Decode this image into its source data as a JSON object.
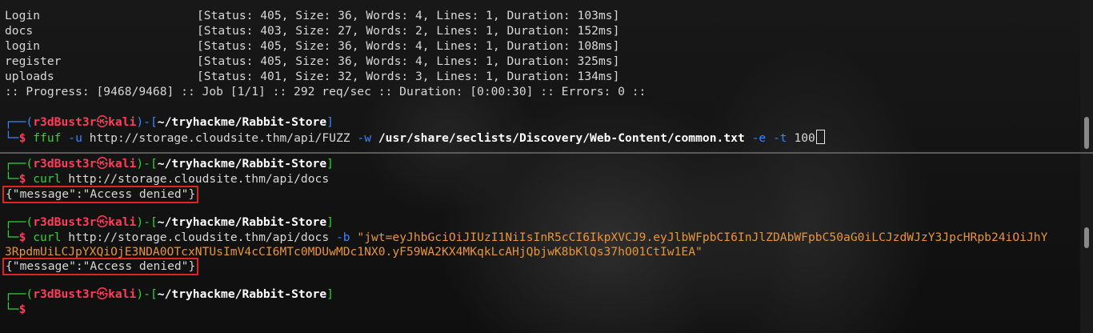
{
  "top_pane": {
    "results": [
      {
        "name": "Login",
        "info": "[Status: 405, Size: 36, Words: 4, Lines: 1, Duration: 103ms]"
      },
      {
        "name": "docs",
        "info": "[Status: 403, Size: 27, Words: 2, Lines: 1, Duration: 152ms]"
      },
      {
        "name": "login",
        "info": "[Status: 405, Size: 36, Words: 4, Lines: 1, Duration: 108ms]"
      },
      {
        "name": "register",
        "info": "[Status: 405, Size: 36, Words: 4, Lines: 1, Duration: 325ms]"
      },
      {
        "name": "uploads",
        "info": "[Status: 401, Size: 32, Words: 3, Lines: 1, Duration: 134ms]"
      }
    ],
    "progress": ":: Progress: [9468/9468] :: Job [1/1] :: 292 req/sec :: Duration: [0:00:30] :: Errors: 0 ::",
    "prompt": {
      "user": "r3dBust3r",
      "skull": "㉿",
      "host": "kali",
      "path": "~/tryhackme/Rabbit-Store"
    },
    "command": {
      "tool": "ffuf",
      "flag_u": "-u",
      "url": "http://storage.cloudsite.thm/api/FUZZ",
      "flag_w": "-w",
      "wordlist": "/usr/share/seclists/Discovery/Web-Content/common.txt",
      "flag_e": "-e",
      "flag_t": "-t",
      "threads": "100"
    }
  },
  "bottom_pane": {
    "prompt": {
      "user": "r3dBust3r",
      "skull": "㉿",
      "host": "kali",
      "path": "~/tryhackme/Rabbit-Store"
    },
    "cmd1": {
      "tool": "curl",
      "url": "http://storage.cloudsite.thm/api/docs"
    },
    "response1": "{\"message\":\"Access denied\"}",
    "cmd2": {
      "tool": "curl",
      "url": "http://storage.cloudsite.thm/api/docs",
      "flag_b": "-b",
      "cookie_line1": "\"jwt=eyJhbGciOiJIUzI1NiIsInR5cCI6IkpXVCJ9.eyJlbWFpbCI6InJlZDAbWFpbC50aG0iLCJzdWJzY3JpcHRpb24iOiJhY",
      "cookie_line2": "3RpdmUiLCJpYXQiOjE3NDA0OTcxNTUsImV4cCI6MTc0MDUwMDc1NX0.yF59WA2KX4MKqkLcAHjQbjwK8bKlQs37hO01CtIw1EA\""
    },
    "response2": "{\"message\":\"Access denied\"}",
    "dollar": "$"
  }
}
